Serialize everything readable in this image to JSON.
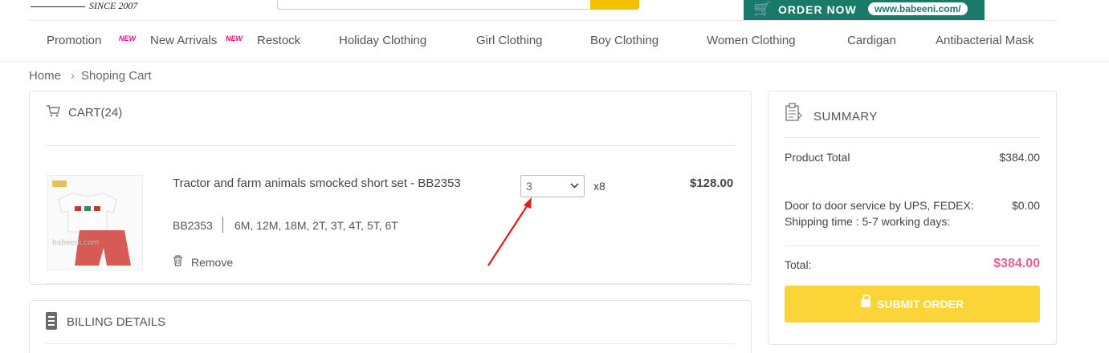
{
  "header": {
    "since_text": "SINCE 2007",
    "order_banner": {
      "label": "ORDER NOW",
      "url": "www.babeeni.com/"
    }
  },
  "nav": {
    "items": [
      {
        "label": "Promotion",
        "new": true
      },
      {
        "label": "New Arrivals",
        "new": true
      },
      {
        "label": "Restock",
        "new": false
      },
      {
        "label": "Holiday Clothing",
        "new": false
      },
      {
        "label": "Girl Clothing",
        "new": false
      },
      {
        "label": "Boy Clothing",
        "new": false
      },
      {
        "label": "Women Clothing",
        "new": false
      },
      {
        "label": "Cardigan",
        "new": false
      },
      {
        "label": "Antibacterial Mask",
        "new": false
      }
    ],
    "new_tag": "NEW"
  },
  "breadcrumb": {
    "home": "Home",
    "separator": "›",
    "current": "Shoping Cart"
  },
  "cart": {
    "title": "CART(24)",
    "items": [
      {
        "name": "Tractor and farm animals smocked short set - BB2353",
        "sku": "BB2353",
        "sizes": "6M, 12M, 18M, 2T, 3T, 4T, 5T, 6T",
        "quantity": "3",
        "multiplier": "x8",
        "price": "$128.00",
        "remove_label": "Remove",
        "image_watermark": "babeeni.com"
      }
    ]
  },
  "billing": {
    "title": "BILLING DETAILS"
  },
  "summary": {
    "title": "SUMMARY",
    "product_total_label": "Product Total",
    "product_total_value": "$384.00",
    "shipping_label_1": "Door to door service by UPS, FEDEX:",
    "shipping_label_2": "Shipping time : 5-7 working days:",
    "shipping_value": "$0.00",
    "total_label": "Total:",
    "total_value": "$384.00",
    "submit_label": "SUBMIT ORDER"
  },
  "colors": {
    "accent_yellow": "#fbd437",
    "total_pink": "#e5608e",
    "banner_green": "#1a7a6a",
    "annotation_red": "#e01b1b"
  }
}
